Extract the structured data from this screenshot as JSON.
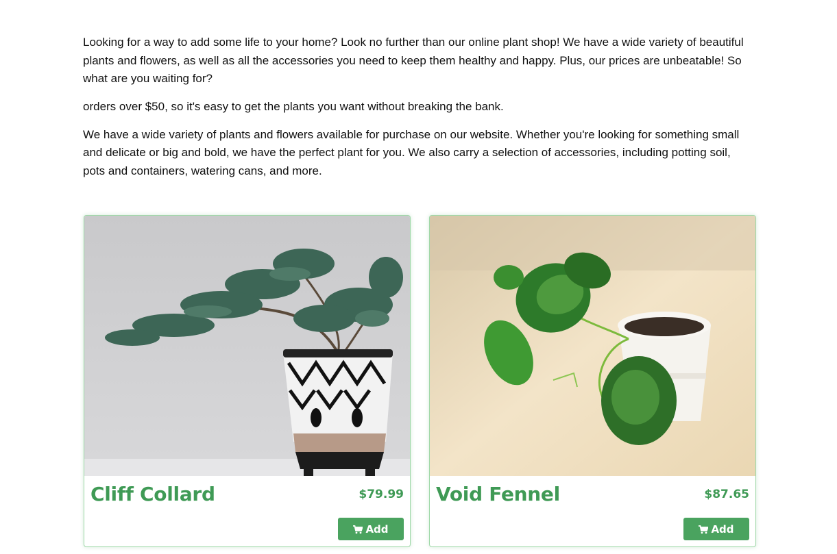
{
  "intro": {
    "paragraph1": "Looking for a way to add some life to your home? Look no further than our online plant shop! We have a wide variety of beautiful plants and flowers, as well as all the accessories you need to keep them healthy and happy. Plus, our prices are unbeatable! So what are you waiting for?",
    "paragraph2": "orders over $50, so it's easy to get the plants you want without breaking the bank.",
    "paragraph3": "We have a wide variety of plants and flowers available for purchase on our website. Whether you're looking for something small and delicate or big and bold, we have the perfect plant for you. We also carry a selection of accessories, including potting soil, pots and containers, watering cans, and more."
  },
  "products": [
    {
      "name": "Cliff Collard",
      "price": "$79.99",
      "add_label": "Add",
      "image": "bonsai-juniper-in-patterned-pot"
    },
    {
      "name": "Void Fennel",
      "price": "$87.65",
      "add_label": "Add",
      "image": "pothos-cutting-in-white-pot"
    }
  ],
  "icons": {
    "cart": "shopping-cart-icon"
  },
  "colors": {
    "accent": "#4aa35f",
    "title": "#3f9a55",
    "card_border": "#9fd8a8"
  }
}
